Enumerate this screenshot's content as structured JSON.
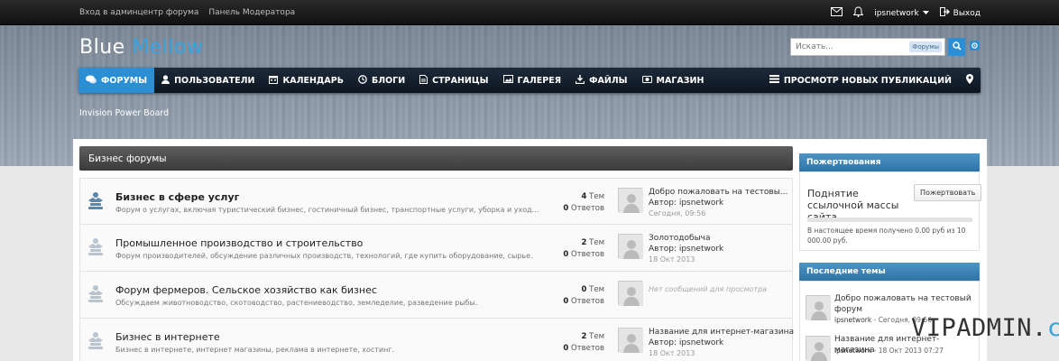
{
  "topbar": {
    "admin_link": "Вход в админцентр форума",
    "mod_link": "Панель Модератора",
    "username": "ipsnetwork",
    "logout": "Выход"
  },
  "logo": {
    "part1": "Blue",
    "part2": "Mellow"
  },
  "search": {
    "placeholder": "Искать...",
    "scope": "Форумы"
  },
  "nav": {
    "items": [
      {
        "label": "ФОРУМЫ",
        "icon": "comments-icon"
      },
      {
        "label": "ПОЛЬЗОВАТЕЛИ",
        "icon": "user-icon"
      },
      {
        "label": "КАЛЕНДАРЬ",
        "icon": "calendar-icon"
      },
      {
        "label": "БЛОГИ",
        "icon": "clock-icon"
      },
      {
        "label": "СТРАНИЦЫ",
        "icon": "page-icon"
      },
      {
        "label": "ГАЛЕРЕЯ",
        "icon": "image-icon"
      },
      {
        "label": "ФАЙЛЫ",
        "icon": "download-icon"
      },
      {
        "label": "МАГАЗИН",
        "icon": "camera-icon"
      }
    ],
    "new_posts": "ПРОСМОТР НОВЫХ ПУБЛИКАЦИЙ"
  },
  "breadcrumb": "Invision Power Board",
  "category": {
    "title": "Бизнес форумы"
  },
  "forums": [
    {
      "title": "Бизнес в сфере услуг",
      "desc": "Форум о услугах, включая туристический бизнес, гостиничный бизнес, транспортные услуги, уборка и уход...",
      "topics": "4",
      "topics_label": "Тем",
      "replies": "0",
      "replies_label": "Ответов",
      "last_title": "Добро пожаловать на тестовы...",
      "last_author": "Автор: ipsnetwork",
      "last_date": "Сегодня, 09:56"
    },
    {
      "title": "Промышленное производство и строительство",
      "desc": "Форум производителей, обсуждение различных производств, технологий, где купить оборудование, сырье.",
      "topics": "2",
      "topics_label": "Тем",
      "replies": "0",
      "replies_label": "Ответов",
      "last_title": "Золотодобыча",
      "last_author": "Автор: ipsnetwork",
      "last_date": "18 Окт 2013"
    },
    {
      "title": "Форум фермеров. Сельское хозяйство как бизнес",
      "desc": "Обсуждаем животноводство, скотоводство, растениеводство, земледелие, разведение рыбы.",
      "topics": "0",
      "topics_label": "Тем",
      "replies": "0",
      "replies_label": "Ответов",
      "no_posts": "Нет сообщений для просмотра"
    },
    {
      "title": "Бизнес в интернете",
      "desc": "Бизнес в интернете, интернет магазины, реклама в интернете, хостинг.",
      "topics": "2",
      "topics_label": "Тем",
      "replies": "0",
      "replies_label": "Ответов",
      "last_title": "Название для интернет-магазина",
      "last_author": "Автор: ipsnetwork",
      "last_date": "18 Окт 2013"
    }
  ],
  "donations": {
    "header": "Пожертвования",
    "title": "Поднятие ссылочной массы сайта",
    "button": "Пожертвовать",
    "progress": 0,
    "note": "В настоящее время получено 0.00 руб из 10 000.00 руб."
  },
  "latest": {
    "header": "Последние темы",
    "topics": [
      {
        "title": "Добро пожаловать на тестовый форум",
        "author": "ipsnetwork",
        "date": "- Сегодня, 09:56"
      },
      {
        "title": "Название для интернет-магазина",
        "author": "ipsnetwork",
        "date": "- 18 Окт 2013 07:27"
      }
    ]
  },
  "watermark": {
    "part1": "VIPADMIN.",
    "part2": "club"
  }
}
